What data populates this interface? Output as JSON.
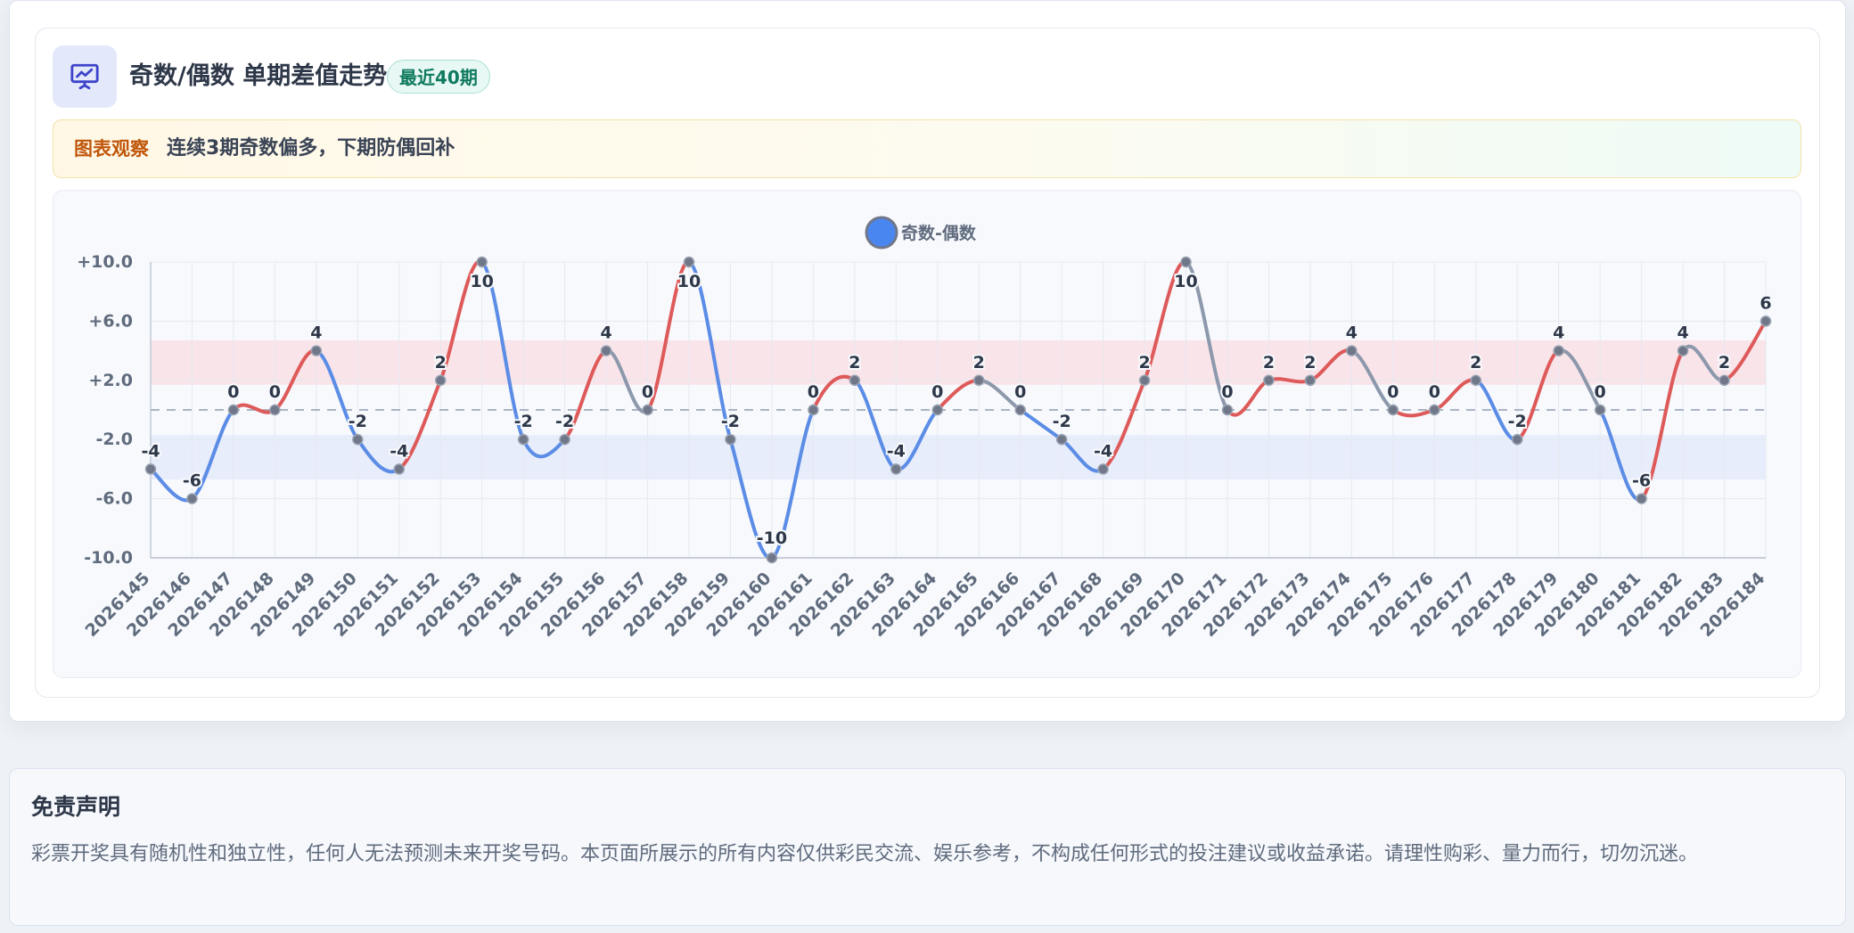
{
  "header": {
    "icon": "presentation-chart-icon",
    "title": "奇数/偶数 单期差值走势",
    "badge": "最近40期"
  },
  "observation": {
    "label": "图表观察",
    "text": "连续3期奇数偏多，下期防偶回补"
  },
  "chart_data": {
    "type": "line",
    "legend": [
      "奇数-偶数"
    ],
    "legend_position": "top-center",
    "categories": [
      "2026145",
      "2026146",
      "2026147",
      "2026148",
      "2026149",
      "2026150",
      "2026151",
      "2026152",
      "2026153",
      "2026154",
      "2026155",
      "2026156",
      "2026157",
      "2026158",
      "2026159",
      "2026160",
      "2026161",
      "2026162",
      "2026163",
      "2026164",
      "2026165",
      "2026166",
      "2026167",
      "2026168",
      "2026169",
      "2026170",
      "2026171",
      "2026172",
      "2026173",
      "2026174",
      "2026175",
      "2026176",
      "2026177",
      "2026178",
      "2026179",
      "2026180",
      "2026181",
      "2026182",
      "2026183",
      "2026184"
    ],
    "series": [
      {
        "name": "奇数-偶数",
        "values": [
          -4,
          -6,
          0,
          0,
          4,
          -2,
          -4,
          2,
          10,
          -2,
          -2,
          4,
          0,
          10,
          -2,
          -10,
          0,
          2,
          -4,
          0,
          2,
          0,
          -2,
          -4,
          2,
          10,
          0,
          2,
          2,
          4,
          0,
          0,
          2,
          -2,
          4,
          0,
          -6,
          4,
          2,
          6
        ]
      }
    ],
    "y_ticks": [
      "+10.0",
      "+6.0",
      "+2.0",
      "-2.0",
      "-6.0",
      "-10.0"
    ],
    "ylim": [
      -10,
      10
    ],
    "reference_line": 0,
    "bands": [
      {
        "from": 1.7,
        "to": 4.7,
        "color": "#f9e1e5"
      },
      {
        "from": -4.7,
        "to": -1.7,
        "color": "#e4ebfa"
      }
    ],
    "grid": true,
    "colors": {
      "up": "#de5a5a",
      "down": "#5b8ce6",
      "neutral": "#8c98ab",
      "point": "#6f7789",
      "legend_dot": "#4a86f0"
    }
  },
  "disclaimer": {
    "title": "免责声明",
    "text": "彩票开奖具有随机性和独立性，任何人无法预测未来开奖号码。本页面所展示的所有内容仅供彩民交流、娱乐参考，不构成任何形式的投注建议或收益承诺。请理性购彩、量力而行，切勿沉迷。"
  }
}
